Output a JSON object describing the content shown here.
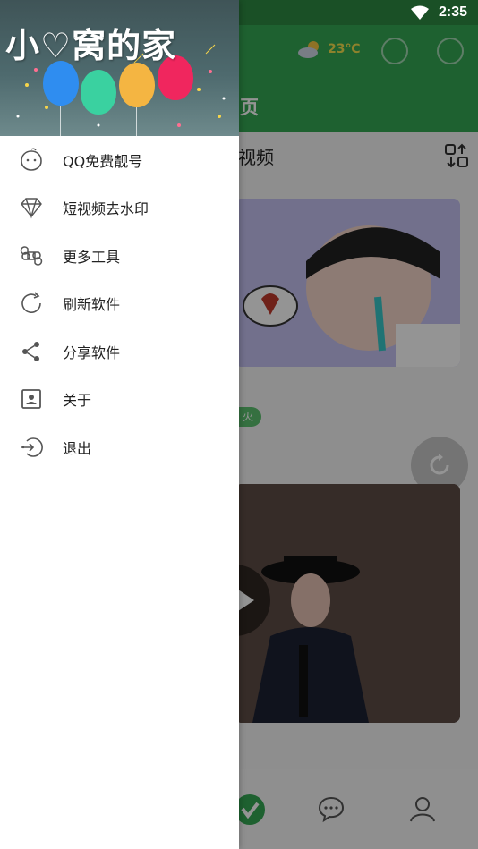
{
  "status_bar": {
    "time": "2:35"
  },
  "drawer": {
    "header_title": "小♡窝的家",
    "menu": [
      {
        "label": "QQ免费靓号",
        "icon": "qq-penguin-icon"
      },
      {
        "label": "短视频去水印",
        "icon": "diamond-icon"
      },
      {
        "label": "更多工具",
        "icon": "command-icon"
      },
      {
        "label": "刷新软件",
        "icon": "refresh-icon"
      },
      {
        "label": "分享软件",
        "icon": "share-icon"
      },
      {
        "label": "关于",
        "icon": "contact-card-icon"
      },
      {
        "label": "退出",
        "icon": "logout-icon"
      }
    ]
  },
  "background": {
    "weather_temp": "23℃",
    "tab_partial": "页",
    "section_partial": "视频",
    "tag_partial": "火"
  },
  "colors": {
    "primary_green": "#34a853",
    "status_green": "#2e8b43"
  }
}
